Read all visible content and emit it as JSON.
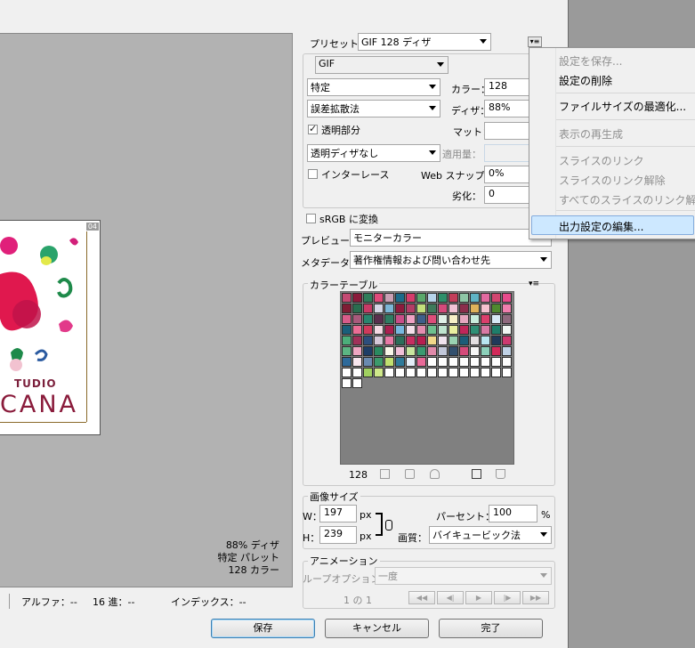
{
  "preset": {
    "label": "プリセット：",
    "value": "GIF 128 ディザ"
  },
  "format": {
    "value": "GIF"
  },
  "reduction": {
    "value": "特定"
  },
  "colors": {
    "label": "カラー：",
    "value": "128"
  },
  "dither_algo": {
    "value": "誤差拡散法"
  },
  "dither": {
    "label": "ディザ：",
    "value": "88%"
  },
  "transparency": {
    "label": "透明部分",
    "checked": true
  },
  "matte": {
    "label": "マット："
  },
  "trans_dither": {
    "value": "透明ディザなし"
  },
  "amount": {
    "label": "適用量："
  },
  "interlaced": {
    "label": "インターレース",
    "checked": false
  },
  "web_snap": {
    "label": "Web スナップ：",
    "value": "0%"
  },
  "lossy": {
    "label": "劣化：",
    "value": "0"
  },
  "srgb": {
    "label": "sRGB に変換",
    "checked": false
  },
  "preview_mode": {
    "label": "プレビュー：",
    "value": "モニターカラー"
  },
  "metadata": {
    "label": "メタデータ：",
    "value": "著作権情報および問い合わせ先"
  },
  "color_table": {
    "title": "カラーテーブル",
    "count": "128",
    "swatches": [
      "#c44a73",
      "#8a1b3b",
      "#2f7d5a",
      "#e04a7a",
      "#caa0b4",
      "#1c6b8a",
      "#d63c6b",
      "#5aa86b",
      "#b6d4ea",
      "#2e8f6a",
      "#c33d5a",
      "#8ec6a6",
      "#5fb3c4",
      "#e26aa0",
      "#d24670",
      "#e84b8c",
      "#7f1c34",
      "#2a6d4f",
      "#c83a66",
      "#d7d7e7",
      "#7bb7d6",
      "#8e1a3d",
      "#b33d66",
      "#c3e07b",
      "#3e7a5b",
      "#d44a7b",
      "#f1c4d6",
      "#8b2d4c",
      "#e0b25b",
      "#f5c2d0",
      "#4f8a2f",
      "#ef7fae",
      "#d85c8a",
      "#a85a7c",
      "#28856e",
      "#5a2e4e",
      "#2f7d63",
      "#c94d88",
      "#f0a2c4",
      "#3e5f8a",
      "#dd4d7a",
      "#e0f0e8",
      "#f7f0c8",
      "#e5a6c0",
      "#c8eddd",
      "#db3f6c",
      "#d7e9f5",
      "#8f6a7e",
      "#1a5f7a",
      "#ea6d95",
      "#cf3a5c",
      "#f3d9e3",
      "#aa2050",
      "#77b8e0",
      "#f4e0ea",
      "#e58eb0",
      "#6ec08e",
      "#bfe4cf",
      "#e9efa0",
      "#c0275a",
      "#2f8f75",
      "#d87aa4",
      "#1e7e6a",
      "#f0f6f2",
      "#4cae7a",
      "#a0325a",
      "#2d4e7c",
      "#d6c8d8",
      "#e87aa6",
      "#2c6e5a",
      "#c72f61",
      "#b81e50",
      "#f2d88a",
      "#f0e4ef",
      "#9ad3b2",
      "#1b5d78",
      "#e4e0e2",
      "#b8e6f0",
      "#203a5a",
      "#cc3a70",
      "#5cb583",
      "#efa6c2",
      "#1e3d66",
      "#2a8a60",
      "#f8f6e8",
      "#f1c0d8",
      "#c8e6a0",
      "#3a9a70",
      "#e08aaa",
      "#c2c8da",
      "#32506e",
      "#d44a7a",
      "#f6f6f6",
      "#8cd0ba",
      "#d22a5a",
      "#c0d2e6",
      "#2e6a9a",
      "#f8e6ee",
      "#6a8ab0",
      "#3c9a6c",
      "#c0e070",
      "#2e7a9a",
      "#e4eef8",
      "#e86a98",
      "#ffffff",
      "#fefefe",
      "#fdfdfd",
      "#fcfcfc",
      "#ffffff",
      "#fefefe",
      "#fdfdfd",
      "#fcfcfc",
      "#ffffff",
      "#fefefe",
      "#a0d060",
      "#cfe88a",
      "#ffffff",
      "#ffffff",
      "#ffffff",
      "#ffffff",
      "#ffffff",
      "#ffffff",
      "#ffffff",
      "#ffffff",
      "#ffffff",
      "#ffffff",
      "#ffffff",
      "#ffffff",
      "#ffffff",
      "#ffffff"
    ]
  },
  "image_size": {
    "title": "画像サイズ",
    "w_label": "W：",
    "w_value": "197",
    "w_unit": "px",
    "h_label": "H：",
    "h_value": "239",
    "h_unit": "px",
    "percent_label": "パーセント：",
    "percent_value": "100",
    "percent_unit": "%",
    "quality_label": "画質：",
    "quality_value": "バイキュービック法"
  },
  "animation": {
    "title": "アニメーション",
    "loop_label": "ループオプション：",
    "loop_value": "一度",
    "frame_counter": "1 の 1"
  },
  "preview_info": {
    "line1": "88% ディザ",
    "line2": "特定 パレット",
    "line3": "128 カラー"
  },
  "image": {
    "text_top": "TUDIO",
    "text_bottom": "CANA",
    "slice_tag": "04"
  },
  "status": {
    "alpha": "アルファ：--",
    "hex": "16 進：--",
    "index": "インデックス：--"
  },
  "buttons": {
    "save": "保存",
    "cancel": "キャンセル",
    "done": "完了"
  },
  "menu": {
    "items": [
      {
        "label": "設定を保存...",
        "disabled": true
      },
      {
        "label": "設定の削除",
        "disabled": false
      },
      {
        "label": "ファイルサイズの最適化...",
        "disabled": false
      },
      {
        "label": "表示の再生成",
        "disabled": true
      },
      {
        "label": "スライスのリンク",
        "disabled": true
      },
      {
        "label": "スライスのリンク解除",
        "disabled": true
      },
      {
        "label": "すべてのスライスのリンク解",
        "disabled": true
      },
      {
        "label": "出力設定の編集...",
        "disabled": false
      }
    ],
    "highlight_color": "#cde8ff"
  }
}
